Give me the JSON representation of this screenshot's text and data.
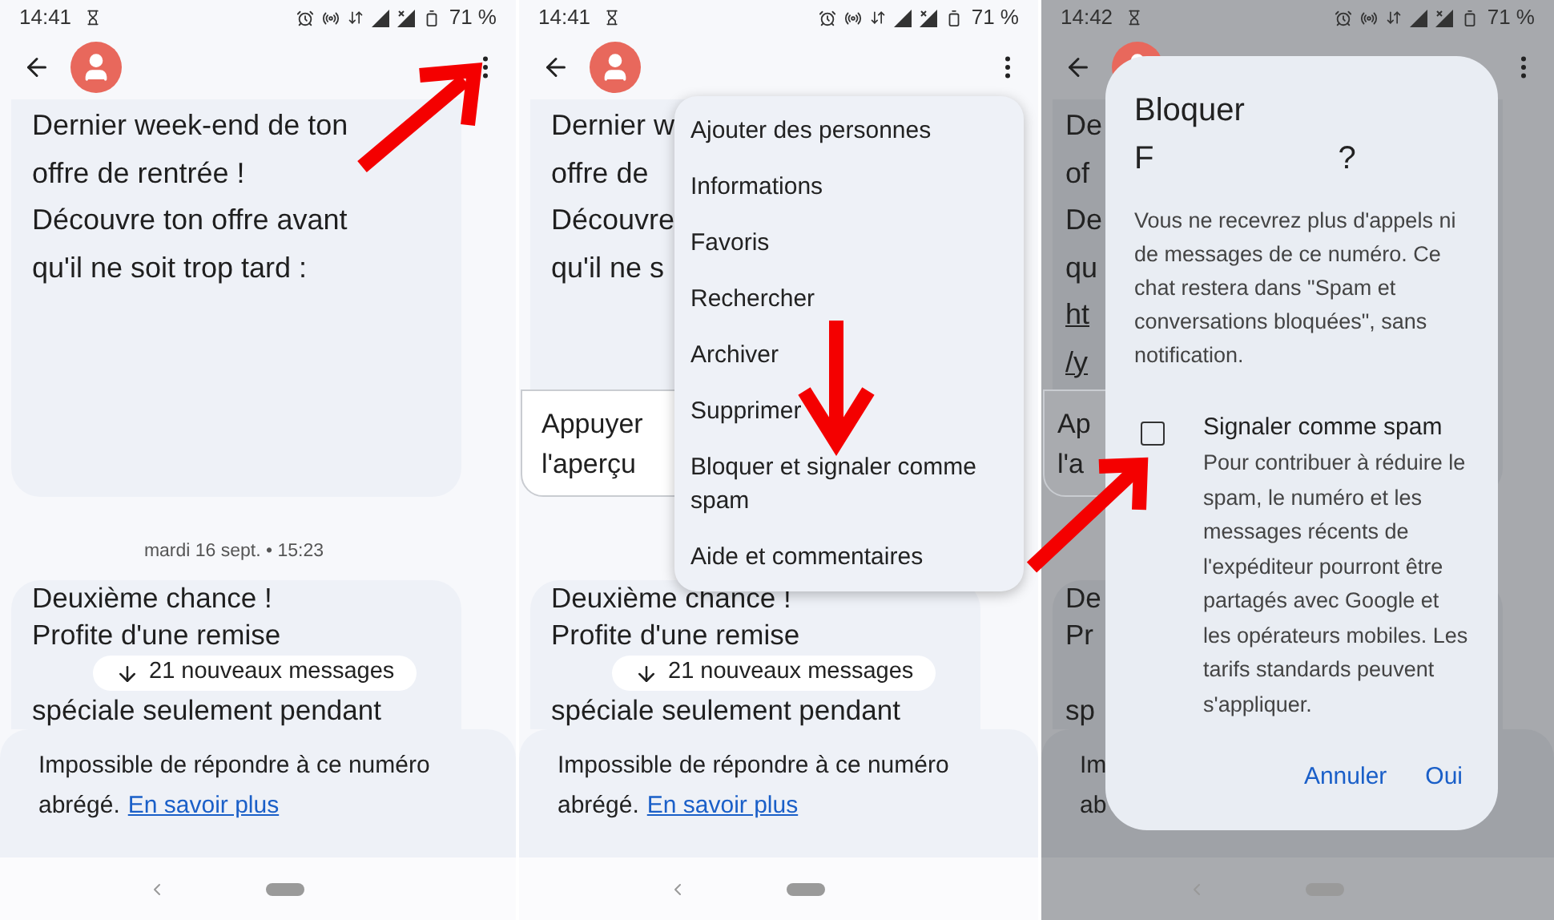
{
  "panels": [
    {
      "dimmed": false,
      "status": {
        "time": "14:41",
        "battery": "71 %"
      },
      "bubble": {
        "lines": [
          "Dernier week-end de ton",
          "offre de rentrée !",
          "Découvre ton offre avant",
          "qu'il ne soit trop tard :"
        ]
      },
      "date": "mardi 16 sept. • 15:23",
      "bubble2": {
        "lines": [
          "Deuxième chance !",
          "Profite d'une remise",
          "spéciale seulement pendant"
        ]
      },
      "new_messages": "21 nouveaux messages",
      "notice": {
        "lines": [
          "Impossible de répondre à ce numéro",
          "abrégé."
        ],
        "link": "En savoir plus"
      }
    },
    {
      "dimmed": false,
      "status": {
        "time": "14:41",
        "battery": "71 %"
      },
      "bubble": {
        "lines": [
          "Dernier w",
          "offre de",
          "Découvre",
          "qu'il ne s"
        ],
        "card": [
          "Appuyer",
          "l'aperçu"
        ]
      },
      "bubble2": {
        "lines": [
          "Deuxième chance !",
          "Profite d'une remise",
          "spéciale seulement pendant"
        ]
      },
      "new_messages": "21 nouveaux messages",
      "notice": {
        "lines": [
          "Impossible de répondre à ce numéro",
          "abrégé."
        ],
        "link": "En savoir plus"
      },
      "menu": [
        "Ajouter des personnes",
        "Informations",
        "Favoris",
        "Rechercher",
        "Archiver",
        "Supprimer",
        "Bloquer et signaler comme spam",
        "Aide et commentaires"
      ]
    },
    {
      "dimmed": true,
      "status": {
        "time": "14:42",
        "battery": "71 %"
      },
      "bubble": {
        "lines": [
          "De",
          "of",
          "De",
          "qu"
        ],
        "links": [
          "ht",
          "/y"
        ],
        "card": [
          "Ap",
          "l'a"
        ]
      },
      "bubble2": {
        "lines": [
          "De",
          "Pr",
          "sp"
        ]
      },
      "notice": {
        "lines": [
          "Im",
          "ab"
        ]
      },
      "dialog": {
        "title": "Bloquer",
        "name_start": "F",
        "name_end": "?",
        "body": "Vous ne recevrez plus d'appels ni de messages de ce numéro. Ce chat restera dans \"Spam et conversations bloquées\", sans notification.",
        "option": {
          "label": "Signaler comme spam",
          "checked": false,
          "description": "Pour contribuer à réduire le spam, le numéro et les messages récents de l'expéditeur pourront être partagés avec Google et les opérateurs mobiles. Les tarifs standards peuvent s'appliquer."
        },
        "buttons": [
          "Annuler",
          "Oui"
        ]
      }
    }
  ]
}
